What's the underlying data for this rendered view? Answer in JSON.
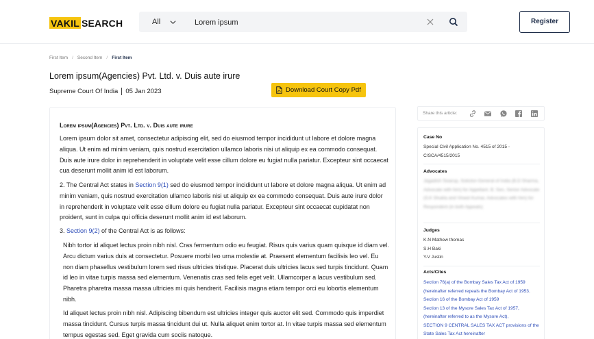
{
  "header": {
    "logo_highlight": "VAKIL",
    "logo_rest": "SEARCH",
    "search": {
      "category": "All",
      "value": "Lorem ipsum",
      "icons": {
        "chevron": "chevron-down-icon",
        "clear": "close-icon",
        "search": "search-icon"
      }
    },
    "register_label": "Register"
  },
  "breadcrumb": [
    "First Item",
    "Second Item",
    "First Item"
  ],
  "case": {
    "title": "Lorem ipsum(Agencies) Pvt. Ltd. v. Duis aute irure",
    "court": "Supreme Court Of India",
    "date": "05 Jan 2023",
    "download_label": "Download Court Copy Pdf"
  },
  "article": {
    "heading": "Lorem ipsum(Agencies) Pvt. Ltd. v. Duis aute irure",
    "p1": "Lorem ipsum dolor sit amet, consectetur adipiscing elit, sed do eiusmod tempor incididunt ut labore et dolore magna aliqua. Ut enim ad minim veniam, quis nostrud exercitation ullamco laboris nisi ut aliquip ex ea commodo consequat. Duis aute irure dolor in reprehenderit in voluptate velit esse cillum dolore eu fugiat nulla pariatur. Excepteur sint occaecat cua deserunt mollit anim id est laborum.",
    "p2_prefix": "2. The Central Act states in ",
    "p2_link": "Section 9(1)",
    "p2_suffix": " sed do eiusmod tempor incididunt ut labore et dolore magna aliqua. Ut enim ad minim veniam, quis nostrud exercitation ullamco laboris nisi ut aliquip ex ea commodo consequat. Duis aute irure dolor in reprehenderit in voluptate velit esse cillum dolore eu fugiat nulla pariatur. Excepteur sint occaecat cupidatat non proident, sunt in culpa qui officia deserunt mollit anim id est laborum.",
    "p3_prefix": "3. ",
    "p3_link": "Section 9(2)",
    "p3_suffix": " of the Central Act is as follows:",
    "q1": "Nibh tortor id aliquet lectus proin nibh nisl. Cras fermentum odio eu feugiat. Risus quis varius quam quisque id diam vel. Arcu dictum varius duis at consectetur. Posuere morbi leo urna molestie at. Praesent elementum facilisis leo vel. Eu non diam phasellus vestibulum lorem sed risus ultricies tristique. Placerat duis ultricies lacus sed turpis tincidunt. Quam id leo in vitae turpis massa sed elementum. Venenatis cras sed felis eget velit. Ullamcorper a lacus vestibulum sed. Pharetra pharetra massa massa ultricies mi quis hendrerit. Facilisis magna etiam tempor orci eu lobortis elementum nibh.",
    "q2": "Id aliquet lectus proin nibh nisl. Adipiscing bibendum est ultricies integer quis auctor elit sed. Commodo quis imperdiet massa tincidunt. Cursus turpis massa tincidunt dui ut. Nulla aliquet enim tortor at. In vitae turpis massa sed elementum tempus egestas sed. Eget gravida cum sociis natoque."
  },
  "sidebar": {
    "share_label": "Share this article:",
    "share_icons": [
      "link-icon",
      "mail-icon",
      "whatsapp-icon",
      "facebook-icon",
      "linkedin-icon"
    ],
    "case_no_label": "Case No",
    "case_no_value": "Special Civil Application No. 4515 of 2015 - C/SCA/4515/2015",
    "advocates_label": "Advocates",
    "advocates_value": "Jagadish Swarup, Solicitor-General of India (B.D Sharma, Advocate with him) for Appellant. B. Sen, Senior Advocate (S.K Shukla and Vineet Kumar, Advocates with him) for Respondent (in both Appeals)",
    "judges_label": "Judges",
    "judges": [
      "K.N Mathew thomas",
      "S.H Baki",
      "Y.V Justin"
    ],
    "acts_label": "Acts/Cites",
    "acts": [
      "Section 76(a) of the Bombay Sales Tax Act of 1959 (hereinafter referred repeals the Bombay Act of 1953.",
      "Section 16 of the Bombay Act of 1959",
      "Section 13 of the Mysore Sales Tax Act of 1957, (hereinafter referred to as the Mysore Act),",
      "SECTION 9 CENTRAL SALES TAX ACT provisions of the State Sales Tax Act hereinafter"
    ]
  },
  "colors": {
    "accent_yellow": "#f6c40e",
    "navy": "#1d2c48",
    "link_blue": "#2b4bb7",
    "border": "#eceef1"
  }
}
